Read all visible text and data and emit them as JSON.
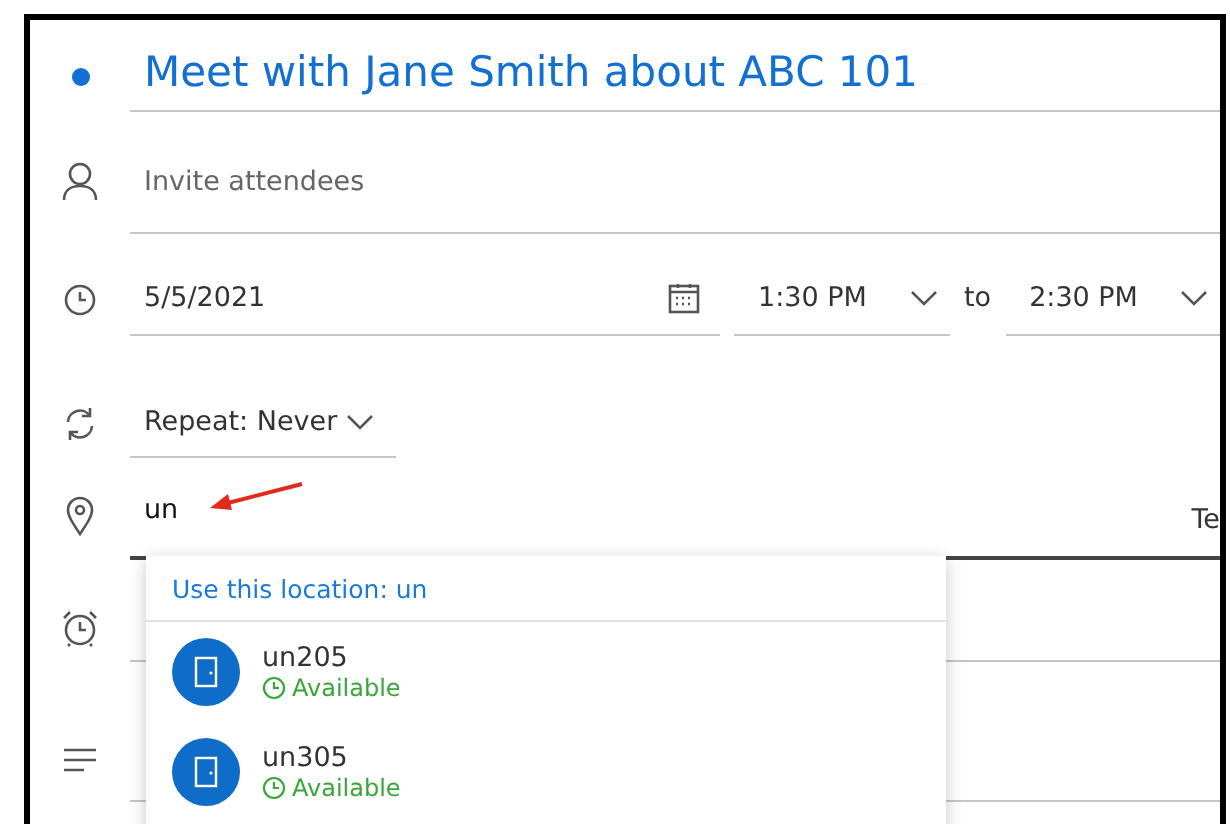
{
  "title": "Meet with Jane Smith about ABC 101",
  "attendees": {
    "placeholder": "Invite attendees"
  },
  "date": "5/5/2021",
  "start_time": "1:30 PM",
  "separator": "to",
  "end_time": "2:30 PM",
  "repeat": {
    "label": "Repeat:",
    "value": "Never"
  },
  "location": {
    "value": "un",
    "trailing_text": "Te"
  },
  "suggestions": {
    "header": "Use this location: un",
    "items": [
      {
        "name": "un205",
        "status": "Available"
      },
      {
        "name": "un305",
        "status": "Available"
      }
    ]
  }
}
